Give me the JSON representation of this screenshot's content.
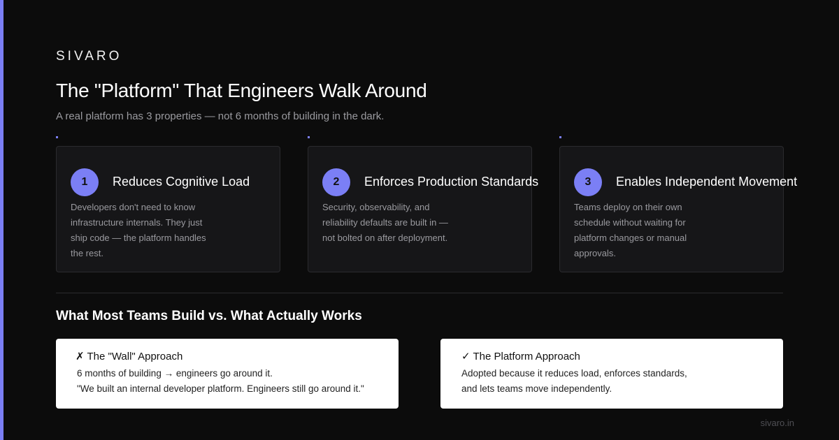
{
  "brand": "SIVARO",
  "title": "The \"Platform\" That Engineers Walk Around",
  "subtitle": "A real platform has 3 properties — not 6 months of building in the dark.",
  "cards": [
    {
      "number": "1",
      "title": "Reduces Cognitive Load",
      "description": "Developers don't need to know infrastructure internals. They just ship code — the platform handles the rest."
    },
    {
      "number": "2",
      "title": "Enforces Production Standards",
      "description": "Security, observability, and reliability defaults are built in — not bolted on after deployment."
    },
    {
      "number": "3",
      "title": "Enables Independent Movement",
      "description": "Teams deploy on their own schedule without waiting for platform changes or manual approvals."
    }
  ],
  "comparison": {
    "title": "What Most Teams Build vs. What Actually Works",
    "wall": {
      "icon": "✗",
      "title": "The \"Wall\" Approach",
      "line1": "6 months of building → engineers go around it.",
      "line2": "\"We built an internal developer platform. Engineers still go around it.\""
    },
    "platform": {
      "icon": "✓",
      "title": "The Platform Approach",
      "line1": "Adopted because it reduces load, enforces standards,",
      "line2": "and lets teams move independently."
    }
  },
  "footer": "sivaro.in",
  "colors": {
    "accent": "#7b7ff5",
    "background": "#0c0c0c",
    "card": "#161618"
  }
}
